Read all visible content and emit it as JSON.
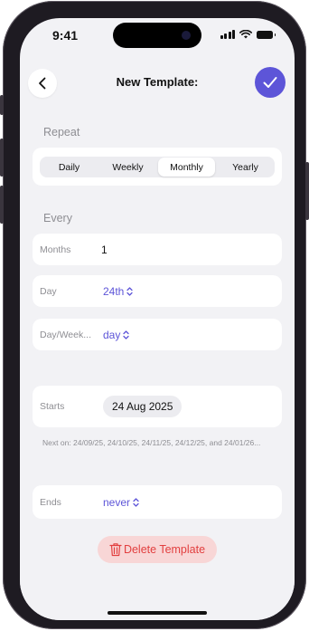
{
  "status_bar": {
    "time": "9:41"
  },
  "nav": {
    "title": "New Template:"
  },
  "repeat": {
    "label": "Repeat",
    "options": [
      "Daily",
      "Weekly",
      "Monthly",
      "Yearly"
    ],
    "selected": "Monthly"
  },
  "every": {
    "label": "Every",
    "months_label": "Months",
    "months_value": "1",
    "day_label": "Day",
    "day_value": "24th",
    "day_week_label": "Day/Week...",
    "day_week_value": "day"
  },
  "starts": {
    "label": "Starts",
    "date": "24 Aug 2025"
  },
  "next_on": "Next on: 24/09/25, 24/10/25, 24/11/25, 24/12/25, and 24/01/26...",
  "ends": {
    "label": "Ends",
    "value": "never"
  },
  "delete_label": "Delete Template",
  "colors": {
    "accent": "#5d55d8",
    "destructive": "#e23f3f",
    "destructive_bg": "#f8d6d6",
    "background": "#f2f2f5"
  }
}
